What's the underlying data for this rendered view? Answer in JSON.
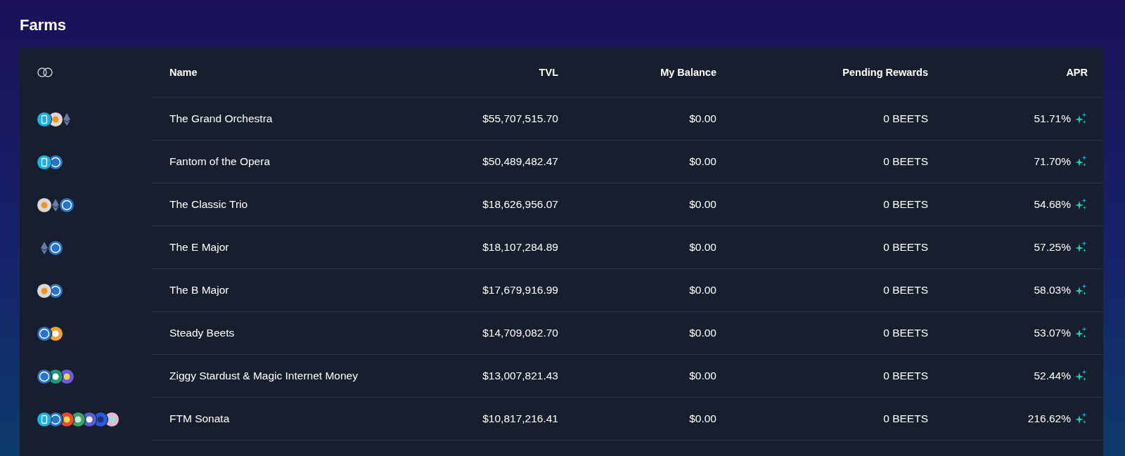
{
  "title": "Farms",
  "columns": [
    "Name",
    "TVL",
    "My Balance",
    "Pending Rewards",
    "APR"
  ],
  "rows": [
    {
      "tokens": [
        {
          "kind": "ftm"
        },
        {
          "kind": "btc"
        },
        {
          "kind": "eth"
        }
      ],
      "name": "The Grand Orchestra",
      "tvl": "$55,707,515.70",
      "balance": "$0.00",
      "pending": "0 BEETS",
      "apr": "51.71%"
    },
    {
      "tokens": [
        {
          "kind": "ftm"
        },
        {
          "kind": "usdc"
        }
      ],
      "name": "Fantom of the Opera",
      "tvl": "$50,489,482.47",
      "balance": "$0.00",
      "pending": "0 BEETS",
      "apr": "71.70%"
    },
    {
      "tokens": [
        {
          "kind": "btc"
        },
        {
          "kind": "eth"
        },
        {
          "kind": "usdc"
        }
      ],
      "name": "The Classic Trio",
      "tvl": "$18,626,956.07",
      "balance": "$0.00",
      "pending": "0 BEETS",
      "apr": "54.68%"
    },
    {
      "tokens": [
        {
          "kind": "eth"
        },
        {
          "kind": "usdc"
        }
      ],
      "name": "The E Major",
      "tvl": "$18,107,284.89",
      "balance": "$0.00",
      "pending": "0 BEETS",
      "apr": "57.25%"
    },
    {
      "tokens": [
        {
          "kind": "btc"
        },
        {
          "kind": "usdc"
        }
      ],
      "name": "The B Major",
      "tvl": "$17,679,916.99",
      "balance": "$0.00",
      "pending": "0 BEETS",
      "apr": "58.03%"
    },
    {
      "tokens": [
        {
          "kind": "usdc"
        },
        {
          "kind": "dai"
        }
      ],
      "name": "Steady Beets",
      "tvl": "$14,709,082.70",
      "balance": "$0.00",
      "pending": "0 BEETS",
      "apr": "53.07%"
    },
    {
      "tokens": [
        {
          "kind": "usdc"
        },
        {
          "kind": "usdt"
        },
        {
          "kind": "mim"
        }
      ],
      "name": "Ziggy Stardust & Magic Internet Money",
      "tvl": "$13,007,821.43",
      "balance": "$0.00",
      "pending": "0 BEETS",
      "apr": "52.44%"
    },
    {
      "tokens": [
        {
          "kind": "ftm"
        },
        {
          "kind": "usdc"
        },
        {
          "kind": "rainbow"
        },
        {
          "kind": "green"
        },
        {
          "kind": "wizard"
        },
        {
          "kind": "chevron"
        },
        {
          "kind": "moon"
        }
      ],
      "name": "FTM Sonata",
      "tvl": "$10,817,216.41",
      "balance": "$0.00",
      "pending": "0 BEETS",
      "apr": "216.62%"
    }
  ]
}
